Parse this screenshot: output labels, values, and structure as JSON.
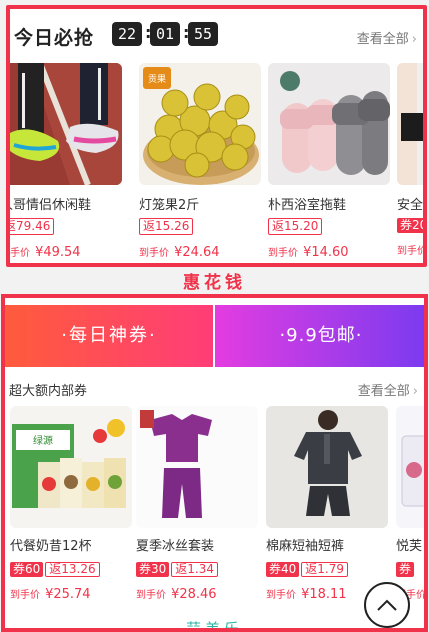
{
  "flash_sale": {
    "title": "今日必抢",
    "countdown": {
      "hours": "22",
      "minutes": "01",
      "seconds": "55"
    },
    "view_all": "查看全部",
    "items": [
      {
        "name": "人哥情侣休闲鞋",
        "rebate": "返79.46",
        "price_label": "到手价",
        "price": "¥49.54",
        "image": "sneakers"
      },
      {
        "name": "灯笼果2斤",
        "rebate": "返15.26",
        "price_label": "到手价",
        "price": "¥24.64",
        "image": "gooseberries"
      },
      {
        "name": "朴西浴室拖鞋",
        "rebate": "返15.20",
        "price_label": "到手价",
        "price": "¥14.60",
        "image": "slippers"
      },
      {
        "name": "安全裤",
        "rebate": "券20",
        "price_label": "到手价",
        "price": "¥",
        "image": "shorts"
      }
    ]
  },
  "divider_title": "惠花钱",
  "coupon_section": {
    "tabs": [
      {
        "label": "·每日神券·"
      },
      {
        "label": "·9.9包邮·"
      }
    ],
    "subtitle": "超大额内部券",
    "view_all": "查看全部",
    "items": [
      {
        "name": "代餐奶昔12杯",
        "coupon": "券60",
        "rebate": "返13.26",
        "price_label": "到手价",
        "price": "¥25.74",
        "image": "milkshake"
      },
      {
        "name": "夏季冰丝套装",
        "coupon": "券30",
        "rebate": "返1.34",
        "price_label": "到手价",
        "price": "¥28.46",
        "image": "pajamas"
      },
      {
        "name": "棉麻短袖短裤",
        "coupon": "券40",
        "rebate": "返1.79",
        "price_label": "到手价",
        "price": "¥18.11",
        "image": "shirt"
      },
      {
        "name": "悦芙",
        "coupon": "券",
        "rebate": "",
        "price_label": "到手价",
        "price": "",
        "image": "cosmetic"
      }
    ],
    "next_title": "蒜美乐"
  },
  "colors": {
    "accent": "#f0334a",
    "tab1": "#ff4d5a",
    "tab2": "#a33be8"
  },
  "back_to_top_icon": "chevron-up-icon"
}
